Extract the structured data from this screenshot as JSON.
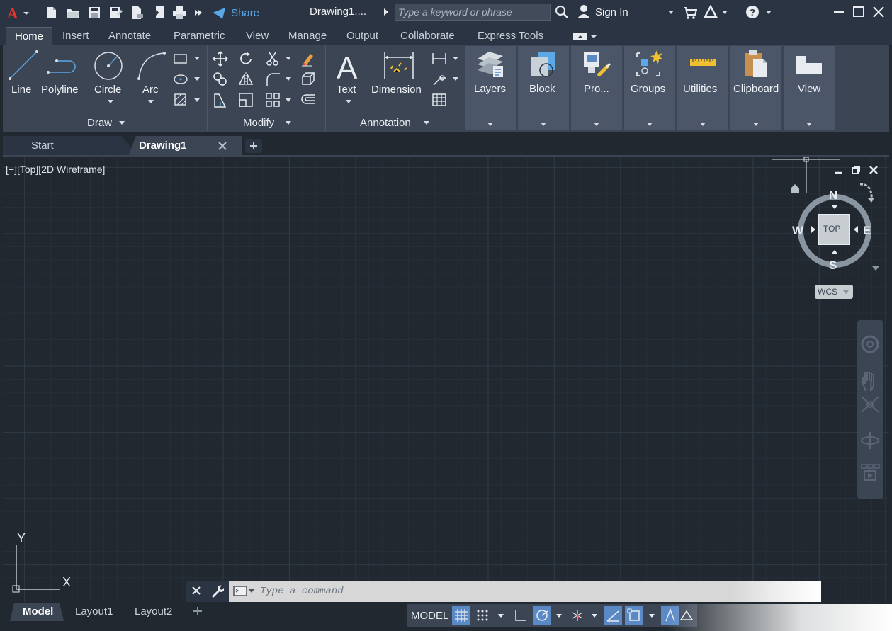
{
  "titlebar": {
    "share_label": "Share",
    "title": "Drawing1....",
    "search_placeholder": "Type a keyword or phrase",
    "signin_label": "Sign In"
  },
  "menu_tabs": [
    "Home",
    "Insert",
    "Annotate",
    "Parametric",
    "View",
    "Manage",
    "Output",
    "Collaborate",
    "Express Tools"
  ],
  "ribbon": {
    "draw": {
      "line": "Line",
      "polyline": "Polyline",
      "circle": "Circle",
      "arc": "Arc",
      "title": "Draw"
    },
    "modify": {
      "title": "Modify"
    },
    "annotation": {
      "text": "Text",
      "dimension": "Dimension",
      "title": "Annotation"
    },
    "tiles": [
      "Layers",
      "Block",
      "Pro...",
      "Groups",
      "Utilities",
      "Clipboard",
      "View"
    ]
  },
  "doc_tabs": {
    "start": "Start",
    "drawing": "Drawing1"
  },
  "viewport": {
    "label": "[−][Top][2D Wireframe]"
  },
  "viewcube": {
    "n": "N",
    "s": "S",
    "e": "E",
    "w": "W",
    "top": "TOP",
    "wcs": "WCS"
  },
  "ucs": {
    "y": "Y",
    "x": "X"
  },
  "command": {
    "placeholder": "Type a command"
  },
  "layout_tabs": [
    "Model",
    "Layout1",
    "Layout2"
  ],
  "status": {
    "model": "MODEL"
  },
  "colors": {
    "accent": "#5aa8e8",
    "background": "#212830",
    "ribbon": "#3b4554",
    "active_toggle": "#5a89c6"
  }
}
